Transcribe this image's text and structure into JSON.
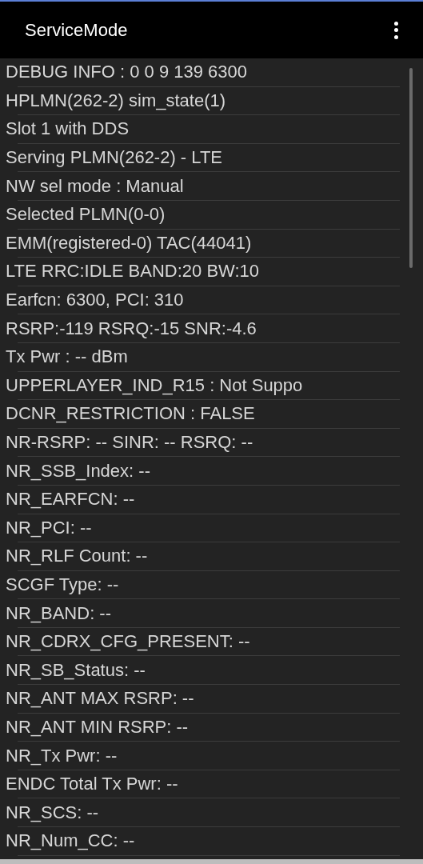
{
  "app_bar": {
    "title": "ServiceMode"
  },
  "lines": [
    "DEBUG INFO : 0 0 9 139 6300",
    "HPLMN(262-2) sim_state(1)",
    "Slot 1 with DDS",
    "Serving PLMN(262-2) - LTE",
    "NW sel mode : Manual",
    "Selected PLMN(0-0)",
    "EMM(registered-0) TAC(44041)",
    "LTE RRC:IDLE BAND:20 BW:10",
    "Earfcn: 6300, PCI: 310",
    "RSRP:-119 RSRQ:-15 SNR:-4.6",
    "Tx Pwr : -- dBm",
    "UPPERLAYER_IND_R15 : Not Suppo",
    "DCNR_RESTRICTION : FALSE",
    "NR-RSRP: -- SINR: -- RSRQ: --",
    "NR_SSB_Index: --",
    "NR_EARFCN: --",
    "NR_PCI: --",
    "NR_RLF Count: --",
    "SCGF Type: --",
    "NR_BAND: --",
    "NR_CDRX_CFG_PRESENT: --",
    "NR_SB_Status: --",
    "NR_ANT MAX RSRP: --",
    "NR_ANT MIN RSRP: --",
    "NR_Tx Pwr: --",
    "ENDC Total Tx Pwr: --",
    "NR_SCS: --",
    "NR_Num_CC: --"
  ]
}
